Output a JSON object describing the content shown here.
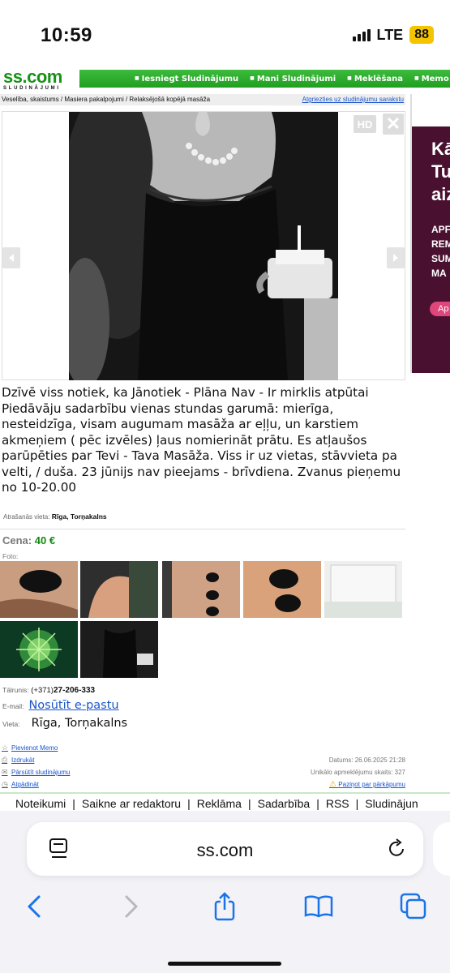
{
  "status": {
    "time": "10:59",
    "network": "LTE",
    "battery": "88"
  },
  "site": {
    "logo": "SS.COM",
    "logo_sub": "SLUDINĀJUMI",
    "nav": [
      "Iesniegt Sludinājumu",
      "Mani Sludinājumi",
      "Meklēšana",
      "Memo"
    ]
  },
  "breadcrumb": {
    "path": "Veselība, skaistums / Masiera pakalpojumi / Relaksējošā kopējā masāža",
    "back_link": "Atgriezties uz sludinājumu sarakstu"
  },
  "gallery": {
    "hd": "HD",
    "close": "✕"
  },
  "ad": {
    "title_lines": [
      "Kā",
      "Tu",
      "aiz"
    ],
    "text_lines": [
      "APF",
      "REM",
      "SUM",
      "MA"
    ],
    "button": "Ap"
  },
  "description": "Dzīvē viss notiek, ka Jānotiek - Plāna Nav - Ir mirklis atpūtai Piedāvāju sadarbību vienas stundas garumā: mierīga, nesteidzīga, visam augumam masāža ar eļļu, un karstiem akmeņiem ( pēc izvēles) ļaus nomierināt prātu. Es atļaušos parūpēties par Tevi - Tava Masāža. Viss ir uz vietas, stāvvieta pa velti, / duša. 23 jūnijs nav pieejams - brīvdiena. Zvanus pieņemu no 10-20.00",
  "location": {
    "label": "Atrašanās vieta:",
    "value": "Rīga, Torņakalns"
  },
  "price": {
    "label": "Cena:",
    "value": "40 €"
  },
  "photos_label": "Foto:",
  "contacts": {
    "phone_label": "Tālrunis:",
    "phone_prefix": "(+371)",
    "phone": "27-206-333",
    "email_label": "E-mail:",
    "email_link": "Nosūtīt e-pastu",
    "place_label": "Vieta:",
    "place_value": "Rīga, Torņakalns"
  },
  "actions": {
    "memo": "Pievienot Memo",
    "print": "Izdrukāt",
    "forward": "Pārsūtīt sludinājumu",
    "unsubscribe": "Atgādināt"
  },
  "meta": {
    "date": "Datums: 26.06.2025 21:28",
    "visits": "Unikālo apmeklējumu skaits: 327",
    "report": "Paziņot par pārkāpumu"
  },
  "footer": [
    "Noteikumi",
    "Saikne ar redaktoru",
    "Reklāma",
    "Sadarbība",
    "RSS",
    "Sludinājun"
  ],
  "browser": {
    "url": "ss.com"
  },
  "colors": {
    "brand_green": "#169316",
    "link_blue": "#1a55cc",
    "price_green": "#118a11"
  }
}
